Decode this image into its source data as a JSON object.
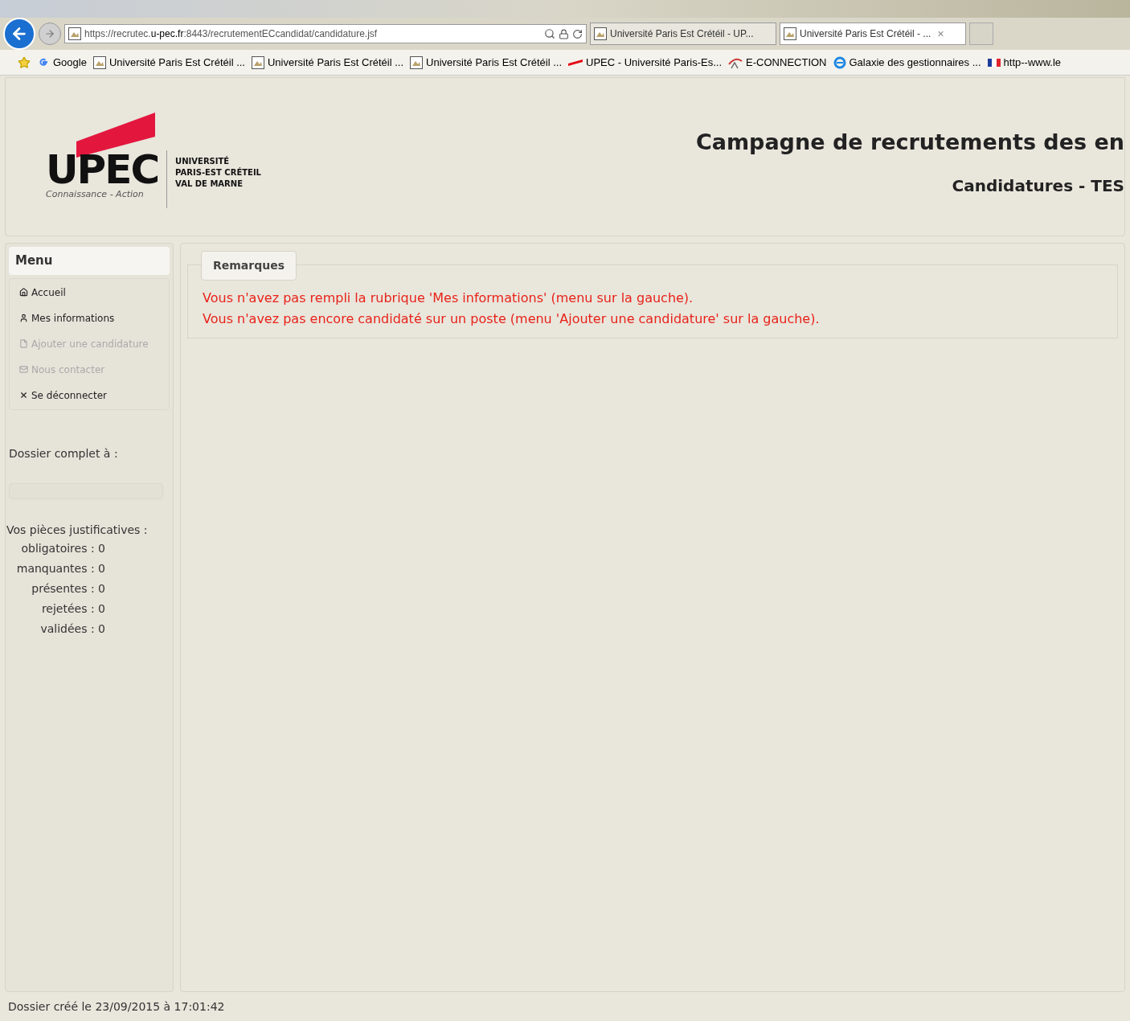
{
  "browser": {
    "address": {
      "prefix": "https://recrutec.",
      "domain": "u-pec.fr",
      "rest": ":8443/recrutementECcandidat/candidature.jsf"
    },
    "tabs": [
      {
        "label": "Université Paris Est Crétéil - UP...",
        "selected": false
      },
      {
        "label": "Université Paris Est Crétéil - ...",
        "selected": true
      }
    ],
    "close_glyph": "×",
    "favorites": [
      {
        "kind": "google",
        "label": "Google"
      },
      {
        "kind": "page",
        "label": "Université Paris Est Crétéil ..."
      },
      {
        "kind": "page",
        "label": "Université Paris Est Crétéil ..."
      },
      {
        "kind": "page",
        "label": "Université Paris Est Crétéil ..."
      },
      {
        "kind": "upec",
        "label": "UPEC - Université Paris-Es..."
      },
      {
        "kind": "econnect",
        "label": "E-CONNECTION"
      },
      {
        "kind": "ie",
        "label": "Galaxie des gestionnaires ..."
      },
      {
        "kind": "flag",
        "label": "http--www.le"
      }
    ]
  },
  "header": {
    "logo": {
      "word": "UPEC",
      "tagline": "Connaissance - Action",
      "lines": [
        "UNIVERSITÉ",
        "PARIS-EST CRÉTEIL",
        "VAL DE MARNE"
      ]
    },
    "title": "Campagne de recrutements des en",
    "subtitle": "Candidatures - TES"
  },
  "sidebar": {
    "menu_title": "Menu",
    "items": [
      {
        "kind": "home",
        "label": "Accueil",
        "disabled": false
      },
      {
        "kind": "user",
        "label": "Mes informations",
        "disabled": false
      },
      {
        "kind": "file",
        "label": "Ajouter une candidature",
        "disabled": true
      },
      {
        "kind": "mail",
        "label": "Nous contacter",
        "disabled": true
      },
      {
        "kind": "logout",
        "label": "Se déconnecter",
        "disabled": false
      }
    ],
    "progress": {
      "label": "Dossier complet à :",
      "level": 0
    },
    "documents": {
      "title": "Vos pièces justificatives :",
      "counts": [
        {
          "label": "obligatoires : 0"
        },
        {
          "label": "manquantes : 0"
        },
        {
          "label": "présentes : 0"
        },
        {
          "label": "rejetées : 0"
        },
        {
          "label": "validées : 0"
        }
      ]
    }
  },
  "remarks": {
    "legend": "Remarques",
    "messages": [
      "Vous n'avez pas rempli la rubrique 'Mes informations' (menu sur la gauche).",
      "Vous n'avez pas encore candidaté sur un poste (menu 'Ajouter une candidature' sur la gauche)."
    ]
  },
  "footer": {
    "text": "Dossier créé le 23/09/2015 à 17:01:42"
  }
}
